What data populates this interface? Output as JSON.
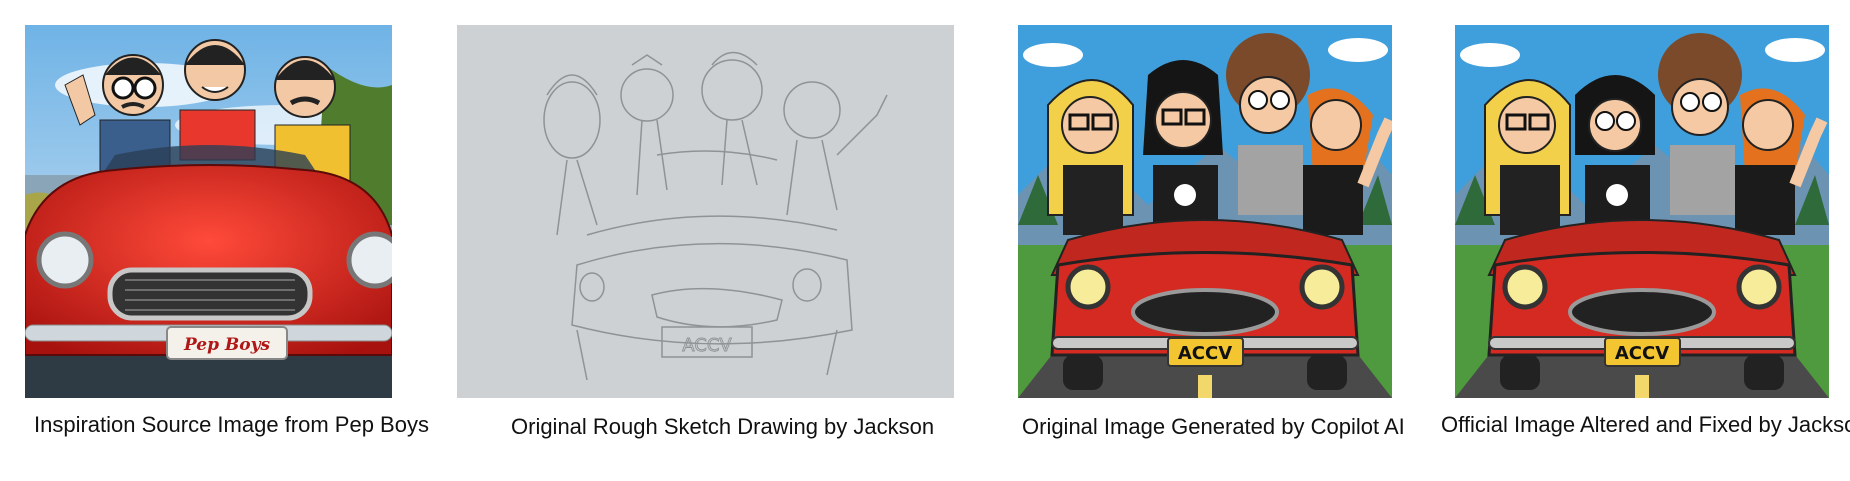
{
  "panels": [
    {
      "caption": "Inspiration Source Image from Pep Boys",
      "plate": "Pep Boys"
    },
    {
      "caption": "Original Rough Sketch Drawing by Jackson",
      "plate": "ACCV"
    },
    {
      "caption": "Original Image Generated by Copilot AI",
      "plate": "ACCV"
    },
    {
      "caption": "Official Image Altered and Fixed by Jackson",
      "plate": "ACCV"
    }
  ],
  "colors": {
    "car_red": "#d42a22",
    "sky_blue": "#3f9fdc",
    "plate_yellow": "#f2c531",
    "pencil": "#9a9a9a"
  }
}
